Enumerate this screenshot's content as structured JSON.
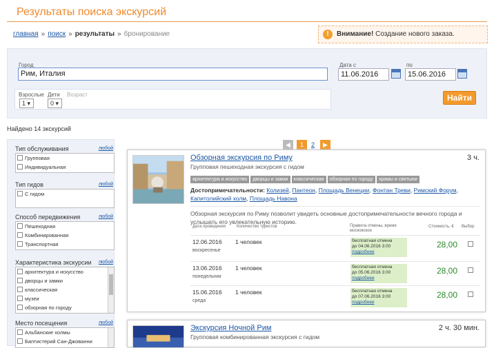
{
  "header": {
    "title": "Результаты поиска экскурсий"
  },
  "breadcrumb": {
    "home": "главная",
    "search": "поиск",
    "results": "результаты",
    "booking": "бронирование",
    "sep": "»"
  },
  "warning": {
    "icon": "exclamation-icon",
    "title": "Внимание!",
    "text": "Создание нового заказа."
  },
  "search": {
    "city_label": "Город",
    "city_value": "Рим, Италия",
    "date_from_label": "Дата с",
    "date_from": "11.06.2016",
    "date_to_label": "по",
    "date_to": "15.06.2016",
    "adults_label": "Взрослые",
    "adults_value": "1 ▾",
    "children_label": "Дети",
    "children_value": "0 ▾",
    "age_label": "Возраст",
    "find_button": "Найти"
  },
  "found": "Найдено 14 экскурсий",
  "pager": {
    "prev": "◀",
    "p1": "1",
    "p2": "2",
    "next": "▶"
  },
  "filters": [
    {
      "title": "Тип обслуживания",
      "any": "любой",
      "options": [
        "Групповая",
        "Индивидуальная"
      ]
    },
    {
      "title": "Тип гидов",
      "any": "любой",
      "options": [
        "С гидом"
      ]
    },
    {
      "title": "Способ передвижения",
      "any": "любой",
      "options": [
        "Пешеходная",
        "Комбинированная",
        "Транспортная"
      ]
    },
    {
      "title": "Характеристика экскурсии",
      "any": "любой",
      "options": [
        "архитектура и искусство",
        "дворцы и замки",
        "классическая",
        "музеи",
        "обзорная по городу"
      ]
    },
    {
      "title": "Место посещения",
      "any": "любой",
      "options": [
        "Альбанские холмы",
        "Баптистерий Сан-Джованни"
      ]
    }
  ],
  "cards": [
    {
      "title": "Обзорная экскурсия по Риму",
      "duration": "3 ч.",
      "subtitle": "Групповая пешеходная экскурсия с гидом",
      "tags": [
        "архитектура и искусство",
        "дворцы и замки",
        "классическая",
        "обзорная по городу",
        "храмы и святыни"
      ],
      "attractions_label": "Достопримечательности:",
      "attractions": [
        "Колизей",
        "Пантеон",
        "Площадь Венеции",
        "Фонтан Треви",
        "Римский Форум",
        "Капитолийский холм",
        "Площадь Навона"
      ],
      "description": "Обзорная экскурсия по Риму позволит увидеть основные достопримечательности вечного города и услышать его увлекательную историю.",
      "cols": {
        "date": "Дата проведения",
        "qty": "Количество туристов",
        "rules": "Правила отмены, время московское",
        "cost": "Стоимость, €",
        "choice": "Выбор"
      },
      "rows": [
        {
          "date": "12.06.2016",
          "weekday": "воскресенье",
          "qty": "1 человек",
          "cancel": "бесплатная отмена",
          "until": "до 04.06.2016 3:00",
          "more": "подробнее",
          "price": "28,00"
        },
        {
          "date": "13.06.2016",
          "weekday": "понедельник",
          "qty": "1 человек",
          "cancel": "бесплатная отмена",
          "until": "до 05.06.2016 3:00",
          "more": "подробнее",
          "price": "28,00"
        },
        {
          "date": "15.06.2016",
          "weekday": "среда",
          "qty": "1 человек",
          "cancel": "бесплатная отмена",
          "until": "до 07.06.2016 3:00",
          "more": "подробнее",
          "price": "28,00"
        }
      ]
    },
    {
      "title": "Экскурсия Ночной Рим",
      "duration": "2 ч. 30 мин.",
      "subtitle": "Групповая комбинированная экскурсия с гидом"
    }
  ],
  "colors": {
    "accent": "#ef8a2c",
    "link": "#1a56a6",
    "price": "#2a8a2a"
  }
}
